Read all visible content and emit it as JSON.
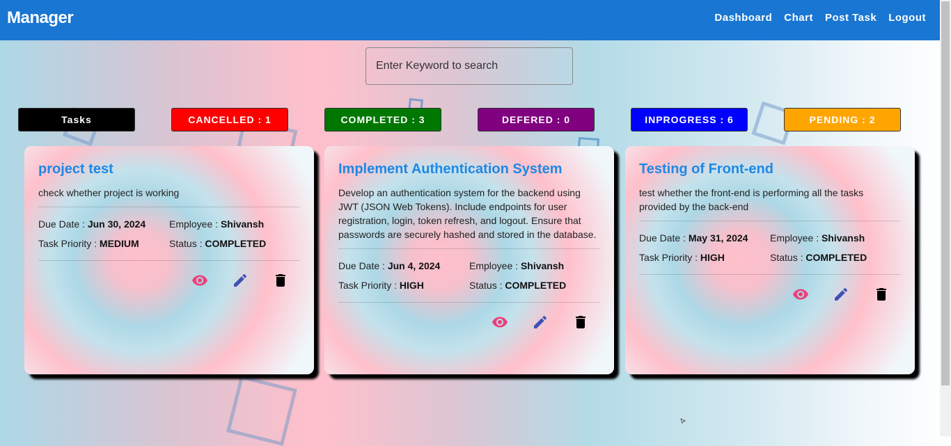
{
  "app": {
    "brand": "Manager"
  },
  "nav": [
    {
      "label": "Dashboard"
    },
    {
      "label": "Chart"
    },
    {
      "label": "Post Task"
    },
    {
      "label": "Logout"
    }
  ],
  "search": {
    "placeholder": "Enter Keyword to search",
    "value": ""
  },
  "chips": [
    {
      "label": "Tasks",
      "color": "#000000"
    },
    {
      "label": "CANCELLED : 1",
      "color": "#ff0000"
    },
    {
      "label": "COMPLETED : 3",
      "color": "#007700"
    },
    {
      "label": "DEFERED : 0",
      "color": "#800080"
    },
    {
      "label": "INPROGRESS : 6",
      "color": "#0000ff"
    },
    {
      "label": "PENDING : 2",
      "color": "#ffa500"
    }
  ],
  "labels": {
    "due_date": "Due Date :",
    "employee": "Employee :",
    "priority": "Task Priority :",
    "status": "Status :"
  },
  "tasks": [
    {
      "title": "project test",
      "description": "check whether project is working",
      "due_date": "Jun 30, 2024",
      "employee": "Shivansh",
      "priority": "MEDIUM",
      "status": "COMPLETED"
    },
    {
      "title": "Implement Authentication System",
      "description": "Develop an authentication system for the backend using JWT (JSON Web Tokens). Include endpoints for user registration, login, token refresh, and logout. Ensure that passwords are securely hashed and stored in the database.",
      "due_date": "Jun 4, 2024",
      "employee": "Shivansh",
      "priority": "HIGH",
      "status": "COMPLETED"
    },
    {
      "title": "Testing of Front-end",
      "description": "test whether the front-end is performing all the tasks provided by the back-end",
      "due_date": "May 31, 2024",
      "employee": "Shivansh",
      "priority": "HIGH",
      "status": "COMPLETED"
    }
  ],
  "colors": {
    "header": "#1976d2",
    "title": "#1e88e5",
    "view_icon": "#ec407a",
    "edit_icon": "#3f51b5",
    "delete_icon": "#000000"
  },
  "icons": {
    "view": "eye-icon",
    "edit": "pencil-icon",
    "delete": "trash-icon"
  }
}
